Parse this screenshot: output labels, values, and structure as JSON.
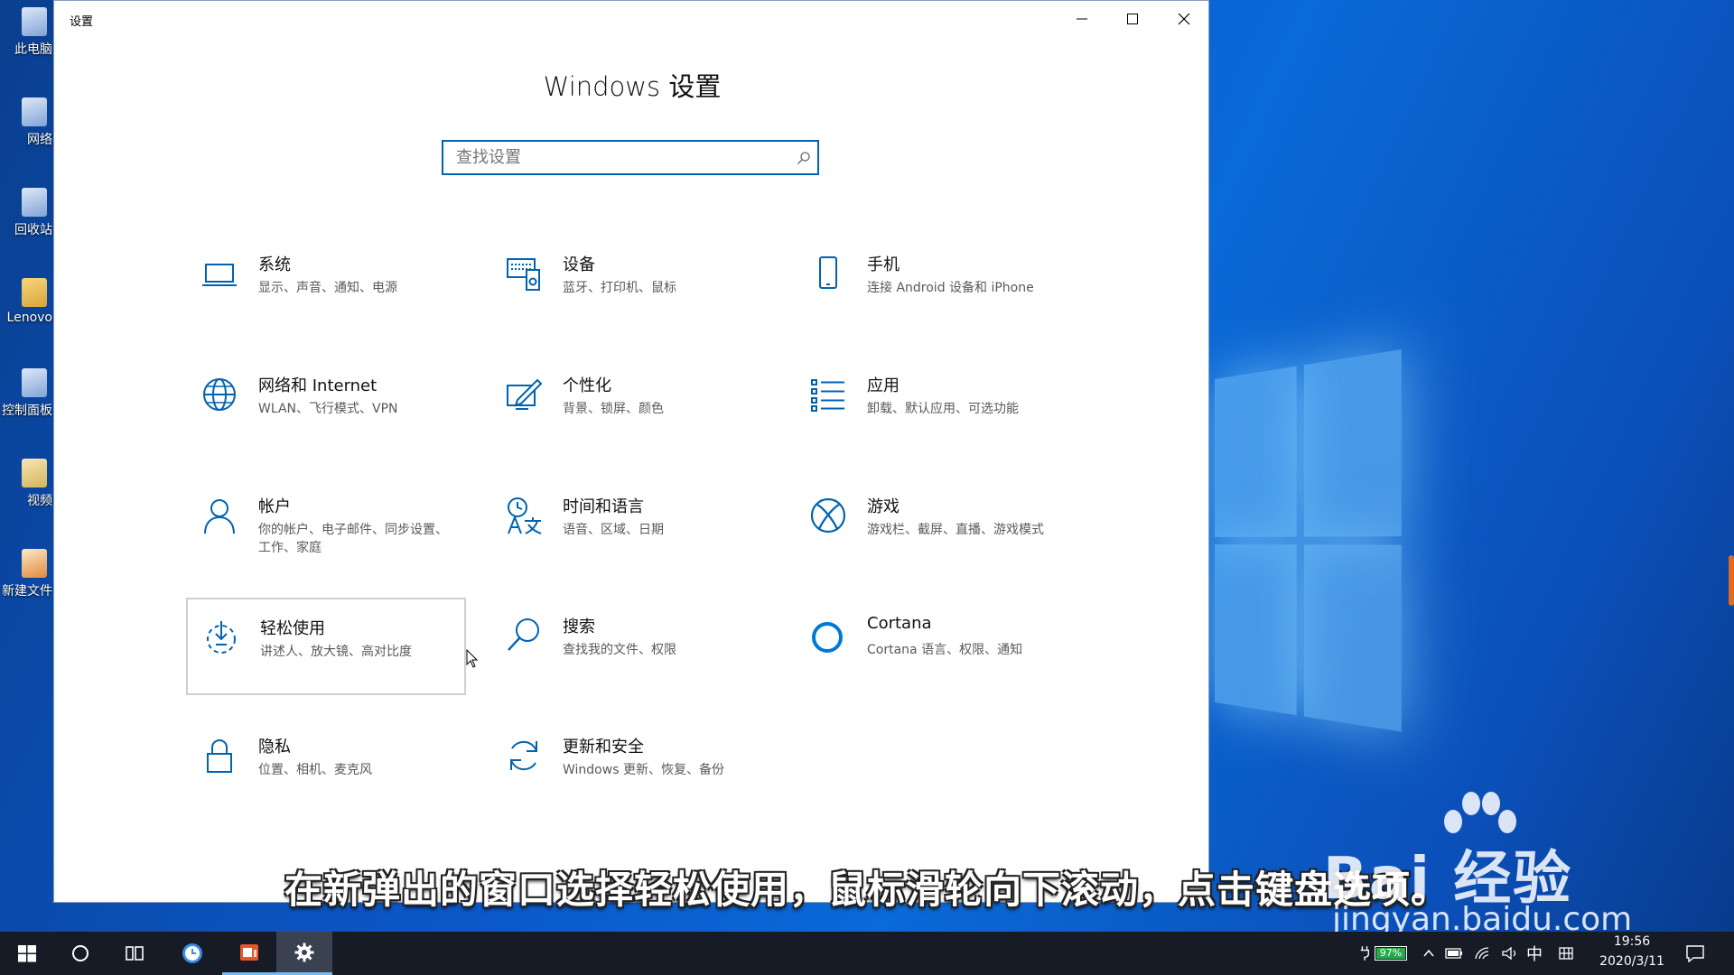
{
  "desktop": {
    "icons": [
      {
        "label": "此电脑",
        "icon": "this-pc-icon"
      },
      {
        "label": "网络",
        "icon": "network-icon"
      },
      {
        "label": "回收站",
        "icon": "recycle-bin-icon"
      },
      {
        "label": "Lenovo",
        "icon": "lenovo-folder-icon"
      },
      {
        "label": "控制面板",
        "icon": "control-panel-icon"
      },
      {
        "label": "视频",
        "icon": "video-icon"
      },
      {
        "label": "新建文件",
        "icon": "new-file-icon"
      }
    ]
  },
  "window": {
    "title": "设置",
    "heading": "Windows 设置",
    "search_placeholder": "查找设置"
  },
  "tiles": [
    {
      "name": "系统",
      "desc": "显示、声音、通知、电源",
      "icon": "laptop-icon"
    },
    {
      "name": "设备",
      "desc": "蓝牙、打印机、鼠标",
      "icon": "devices-icon"
    },
    {
      "name": "手机",
      "desc": "连接 Android 设备和 iPhone",
      "icon": "phone-icon"
    },
    {
      "name": "网络和 Internet",
      "desc": "WLAN、飞行模式、VPN",
      "icon": "globe-icon"
    },
    {
      "name": "个性化",
      "desc": "背景、锁屏、颜色",
      "icon": "personalization-icon"
    },
    {
      "name": "应用",
      "desc": "卸载、默认应用、可选功能",
      "icon": "apps-list-icon"
    },
    {
      "name": "帐户",
      "desc": "你的帐户、电子邮件、同步设置、工作、家庭",
      "icon": "person-icon"
    },
    {
      "name": "时间和语言",
      "desc": "语音、区域、日期",
      "icon": "time-language-icon"
    },
    {
      "name": "游戏",
      "desc": "游戏栏、截屏、直播、游戏模式",
      "icon": "xbox-icon"
    },
    {
      "name": "轻松使用",
      "desc": "讲述人、放大镜、高对比度",
      "icon": "ease-of-access-icon"
    },
    {
      "name": "搜索",
      "desc": "查找我的文件、权限",
      "icon": "search-icon"
    },
    {
      "name": "Cortana",
      "desc": "Cortana 语言、权限、通知",
      "icon": "cortana-icon"
    },
    {
      "name": "隐私",
      "desc": "位置、相机、麦克风",
      "icon": "lock-icon"
    },
    {
      "name": "更新和安全",
      "desc": "Windows 更新、恢复、备份",
      "icon": "update-icon"
    }
  ],
  "subtitle": "在新弹出的窗口选择轻松使用，鼠标滑轮向下滚动，点击键盘选项。",
  "watermark": {
    "brand": "Bai 经验",
    "url": "jingyan.baidu.com"
  },
  "taskbar": {
    "battery": "97%",
    "ime": "中",
    "time": "19:56",
    "date": "2020/3/11"
  },
  "colors": {
    "accent": "#0063b1",
    "taskbar": "#161b26",
    "desktop": "#0b57c8"
  }
}
